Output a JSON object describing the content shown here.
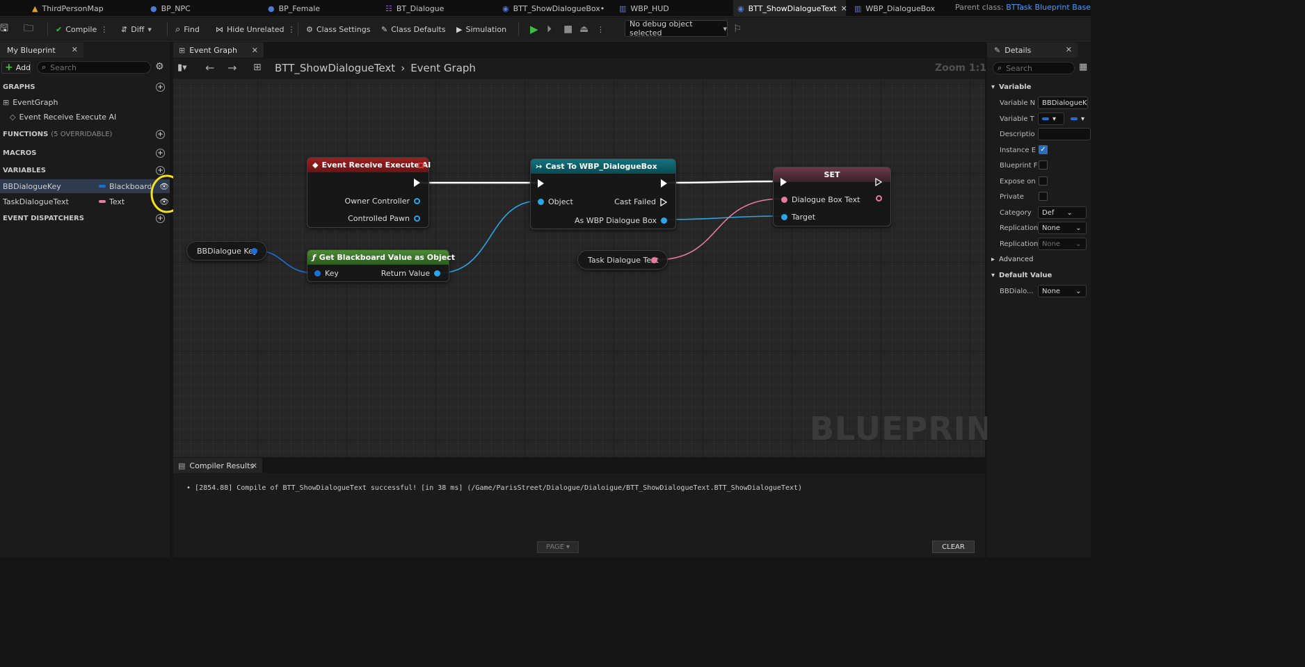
{
  "tabs": [
    {
      "label": "ThirdPersonMap",
      "icon": "level-icon"
    },
    {
      "label": "BP_NPC",
      "icon": "character-icon"
    },
    {
      "label": "BP_Female",
      "icon": "character-icon"
    },
    {
      "label": "BT_Dialogue",
      "icon": "behavior-tree-icon"
    },
    {
      "label": "BTT_ShowDialogueBox•",
      "icon": "task-icon"
    },
    {
      "label": "WBP_HUD",
      "icon": "widget-icon"
    },
    {
      "label": "BTT_ShowDialogueText",
      "icon": "task-icon"
    },
    {
      "label": "WBP_DialogueBox",
      "icon": "widget-icon"
    }
  ],
  "parent_class": {
    "label": "Parent class:",
    "value": "BTTask Blueprint Base"
  },
  "toolbar": {
    "compile": "Compile",
    "diff": "Diff",
    "find": "Find",
    "hide_unrelated": "Hide Unrelated",
    "class_settings": "Class Settings",
    "class_defaults": "Class Defaults",
    "simulation": "Simulation",
    "debug_object": "No debug object selected"
  },
  "my_blueprint": {
    "title": "My Blueprint",
    "add": "Add",
    "search_placeholder": "Search",
    "graphs_header": "GRAPHS",
    "event_graph": "EventGraph",
    "event_receive": "Event Receive Execute AI",
    "functions_header": "FUNCTIONS",
    "functions_count": "(5 OVERRIDABLE)",
    "macros_header": "MACROS",
    "variables_header": "VARIABLES",
    "variables": [
      {
        "name": "BBDialogueKey",
        "type": "Blackboard K",
        "color": "#1d6fd6"
      },
      {
        "name": "TaskDialogueText",
        "type": "Text",
        "color": "#e57ca0"
      }
    ],
    "dispatchers_header": "EVENT DISPATCHERS"
  },
  "graph": {
    "tab": "Event Graph",
    "breadcrumb_root": "BTT_ShowDialogueText",
    "breadcrumb_leaf": "Event Graph",
    "zoom": "Zoom 1:1",
    "watermark": "BLUEPRINT",
    "nodes": {
      "event": {
        "title": "Event Receive Execute AI",
        "pin_owner": "Owner Controller",
        "pin_pawn": "Controlled Pawn",
        "color": "#8b1c1c"
      },
      "cast": {
        "title": "Cast To WBP_DialogueBox",
        "pin_object": "Object",
        "pin_failed": "Cast Failed",
        "pin_as": "As WBP Dialogue Box",
        "color": "#0f5f66"
      },
      "set": {
        "title": "SET",
        "pin_text": "Dialogue Box Text",
        "pin_target": "Target"
      },
      "getbb": {
        "title": "Get Blackboard Value as Object",
        "pin_key": "Key",
        "pin_return": "Return Value",
        "color": "#3a6b2a"
      },
      "bbkey": {
        "label": "BBDialogue Key"
      },
      "tasktext": {
        "label": "Task Dialogue Text"
      }
    }
  },
  "compiler": {
    "title": "Compiler Results",
    "log": "[2854.88] Compile of BTT_ShowDialogueText successful! [in 38 ms] (/Game/ParisStreet/Dialogue/Dialoigue/BTT_ShowDialogueText.BTT_ShowDialogueText)",
    "page": "PAGE",
    "clear": "CLEAR"
  },
  "details": {
    "title": "Details",
    "search_placeholder": "Search",
    "variable_header": "Variable",
    "rows": {
      "name_label": "Variable N",
      "name_value": "BBDialogueK",
      "type_label": "Variable T",
      "desc_label": "Descriptio",
      "instance_label": "Instance E",
      "bp_label": "Blueprint F",
      "expose_label": "Expose on",
      "private_label": "Private",
      "category_label": "Category",
      "category_value": "Def",
      "rep1_label": "Replication",
      "rep1_value": "None",
      "rep2_label": "Replication",
      "rep2_value": "None"
    },
    "advanced": "Advanced",
    "default_header": "Default Value",
    "default_label": "BBDialo...",
    "default_value": "None"
  }
}
